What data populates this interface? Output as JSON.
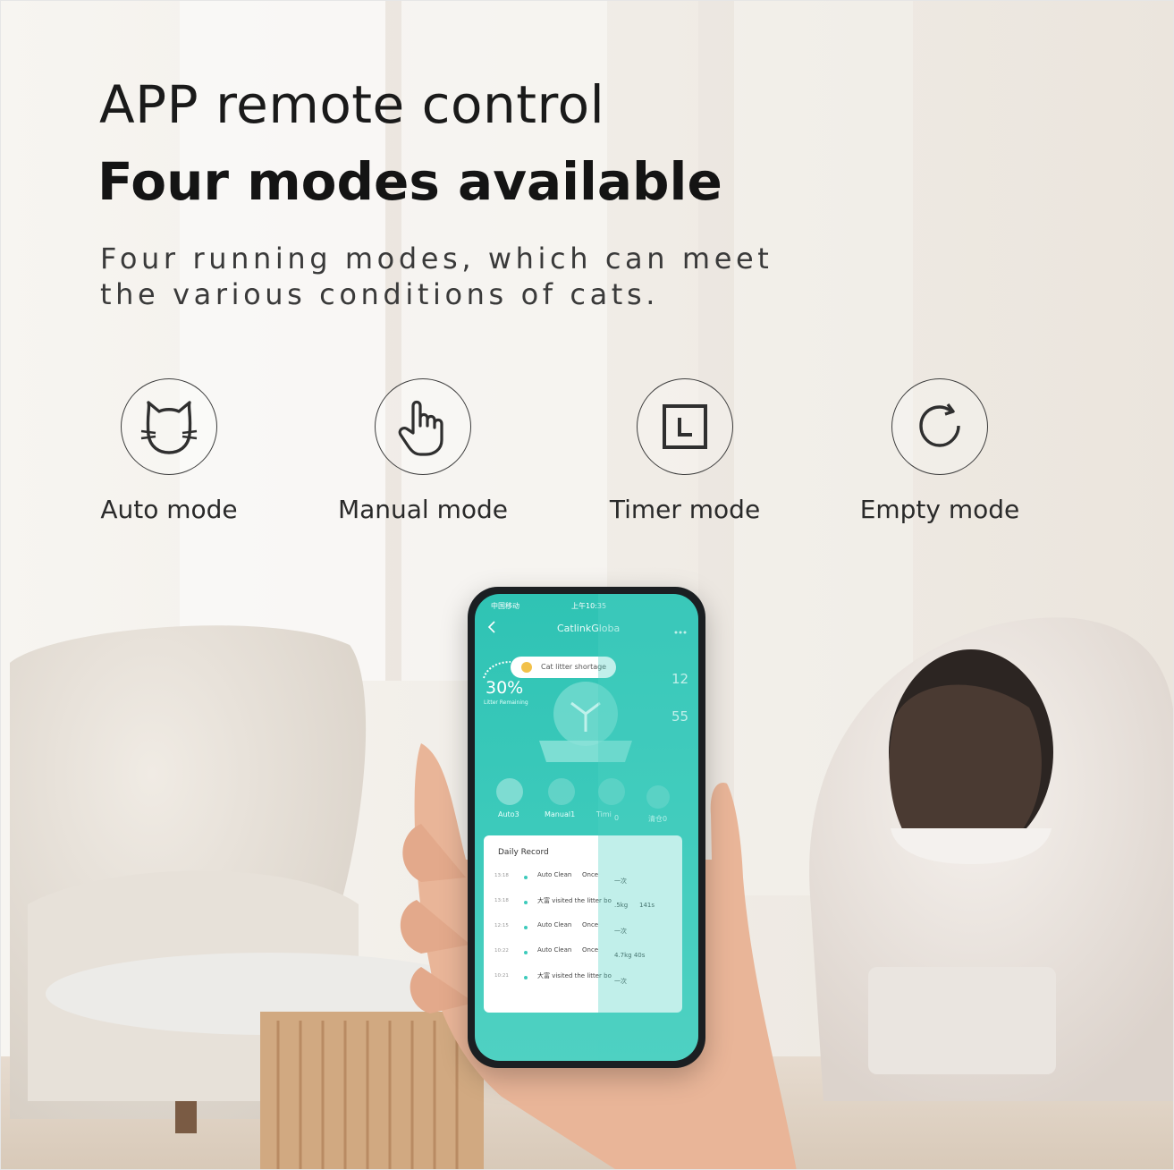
{
  "headline": "APP remote control",
  "subheadline": "Four modes available",
  "description": "Four running modes, which can meet the various conditions of cats.",
  "modes": [
    {
      "label": "Auto mode",
      "icon": "cat-face-icon"
    },
    {
      "label": "Manual mode",
      "icon": "hand-pointer-icon"
    },
    {
      "label": "Timer mode",
      "icon": "timer-square-icon"
    },
    {
      "label": "Empty mode",
      "icon": "refresh-circle-icon"
    }
  ],
  "phone": {
    "status_carrier": "中国移动",
    "status_time": "上午10:35",
    "app_title": "CatlinkGloba",
    "alert": "Cat litter shortage",
    "litter_percent": "30%",
    "litter_label": "Litter Remaining",
    "metric_1": "12",
    "metric_2": "55",
    "mode_buttons": [
      "Auto3",
      "Manual1",
      "Timi",
      "0",
      "清仓0"
    ],
    "daily_record_title": "Daily Record",
    "records": [
      {
        "time": "13:18",
        "event": "Auto Clean",
        "count": "Once",
        "extra": "一次"
      },
      {
        "time": "13:18",
        "event": "大富 visited the litter bo",
        "count": ".5kg",
        "extra": "141s"
      },
      {
        "time": "12:15",
        "event": "Auto Clean",
        "count": "Once",
        "extra": "一次"
      },
      {
        "time": "10:22",
        "event": "Auto Clean",
        "count": "Once",
        "extra": "4.7kg 40s"
      },
      {
        "time": "10:21",
        "event": "大富 visited the litter bo",
        "count": "",
        "extra": "一次"
      }
    ]
  },
  "colors": {
    "accent_teal": "#3ccabb",
    "text_dark": "#1a1a1a",
    "wall": "#f2efea"
  }
}
